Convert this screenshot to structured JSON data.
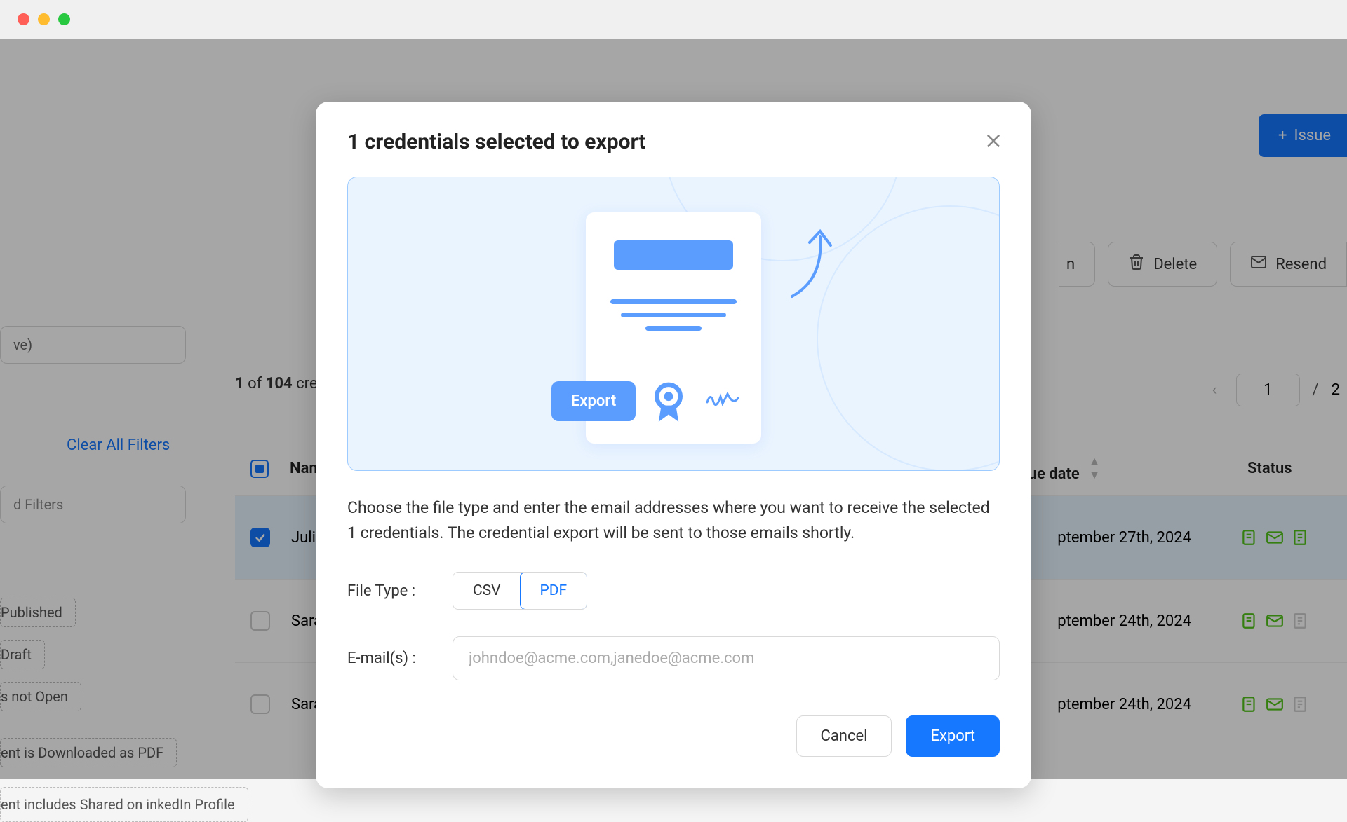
{
  "toolbar": {
    "issue_label": "Issue",
    "delete_label": "Delete",
    "resend_label": "Resend"
  },
  "sidebar": {
    "top_input_partial": "ve)",
    "clear_filters": "Clear All Filters",
    "saved_filters_placeholder": "d Filters",
    "chips": {
      "published": "Published",
      "draft": "Draft",
      "not_open": "s not Open",
      "downloaded": "ent is Downloaded as PDF",
      "linkedin": "ent includes Shared on inkedIn Profile"
    }
  },
  "count": {
    "selected": "1",
    "of": "of",
    "total": "104",
    "suffix": "crec"
  },
  "pagination": {
    "current": "1",
    "separator": "/",
    "total": "2"
  },
  "table": {
    "headers": {
      "name": "Name",
      "issue_date": "ue date",
      "status": "Status"
    },
    "rows": [
      {
        "name": "Julie",
        "date": "ptember 27th, 2024",
        "checked": true
      },
      {
        "name": "Sara",
        "date": "ptember 24th, 2024",
        "checked": false
      },
      {
        "name": "Sara",
        "date": "ptember 24th, 2024",
        "checked": false
      }
    ]
  },
  "modal": {
    "title": "1 credentials selected to export",
    "hero_export": "Export",
    "body": "Choose the file type and enter the email addresses where you want to receive the selected 1 credentials. The credential export will be sent to those emails shortly.",
    "file_type_label": "File Type :",
    "csv": "CSV",
    "pdf": "PDF",
    "email_label": "E-mail(s) :",
    "email_placeholder": "johndoe@acme.com,janedoe@acme.com",
    "cancel": "Cancel",
    "export": "Export"
  }
}
